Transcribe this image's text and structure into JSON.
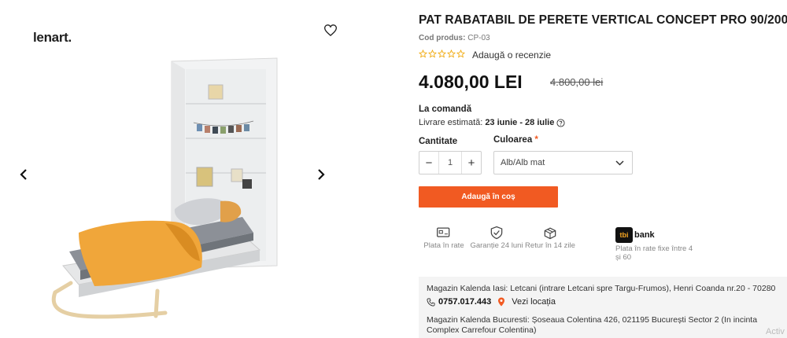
{
  "brand": {
    "logo_text": "lenart."
  },
  "gallery": {
    "favorite_icon": "heart-outline-icon",
    "prev_icon": "chevron-left-icon",
    "next_icon": "chevron-right-icon"
  },
  "product": {
    "title": "PAT RABATABIL DE PERETE VERTICAL CONCEPT PRO 90/200",
    "sku_label": "Cod produs:",
    "sku_value": "CP-03",
    "rating_stars": 5,
    "rating_filled": 0,
    "review_link": "Adaugă o recenzie",
    "price": "4.080,00 LEI",
    "old_price": "4.800,00 lei",
    "availability": "La comandă",
    "delivery_label": "Livrare estimată:",
    "delivery_dates": "23 iunie - 28 iulie"
  },
  "purchase": {
    "quantity_label": "Cantitate",
    "quantity_value": "1",
    "minus": "−",
    "plus": "+",
    "color_label": "Culoarea",
    "color_required": "*",
    "color_selected": "Alb/Alb mat",
    "add_to_cart": "Adaugă în coș"
  },
  "benefits": [
    {
      "icon": "card-icon",
      "text": "Plata în rate"
    },
    {
      "icon": "shield-check-icon",
      "text": "Garanție 24 luni"
    },
    {
      "icon": "box-return-icon",
      "text": "Retur în 14 zile"
    }
  ],
  "tbi": {
    "logo": "tbi",
    "name": "bank",
    "text": "Plata în rate fixe între 4 și 60"
  },
  "stores": {
    "store1": "Magazin Kalenda Iasi: Letcani (intrare Letcani spre Targu-Frumos), Henri Coanda nr.20 - 70280",
    "phone": "0757.017.443",
    "location_link": "Vezi locația",
    "store2": "Magazin Kalenda Bucuresti: Șoseaua Colentina 426, 021195 București Sector 2 (In incinta Complex Carrefour Colentina)"
  },
  "watermark": "Activ",
  "colors": {
    "accent": "#f15a22",
    "text": "#222222",
    "muted": "#888888",
    "panel": "#f4f4f4"
  }
}
